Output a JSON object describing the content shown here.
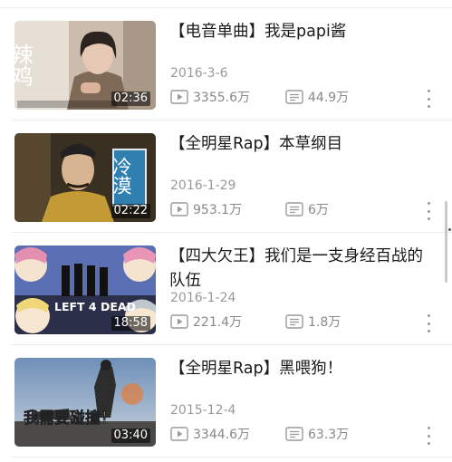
{
  "videos": [
    {
      "title": "【电音单曲】我是papi酱",
      "date": "2016-3-6",
      "duration": "02:36",
      "plays": "3355.6万",
      "danmaku": "44.9万",
      "thumb_text": "辣鸡"
    },
    {
      "title": "【全明星Rap】本草纲目",
      "date": "2016-1-29",
      "duration": "02:22",
      "plays": "953.1万",
      "danmaku": "6万",
      "thumb_text": "冷漠"
    },
    {
      "title": "【四大欠王】我们是一支身经百战的队伍",
      "date": "2016-1-24",
      "duration": "18:58",
      "plays": "221.4万",
      "danmaku": "1.8万",
      "thumb_text": "LEFT 4 DEAD"
    },
    {
      "title": "【全明星Rap】黑喂狗！",
      "date": "2015-12-4",
      "duration": "03:40",
      "plays": "3344.6万",
      "danmaku": "63.3万",
      "thumb_text": "我需要碰撞！"
    }
  ],
  "icons": {
    "play": "play-count-icon",
    "danmaku": "danmaku-icon",
    "more": "more-icon"
  },
  "colors": {
    "title": "#1a1a1a",
    "meta": "#999999",
    "divider": "#ececec",
    "icon": "#9a9a9a"
  }
}
